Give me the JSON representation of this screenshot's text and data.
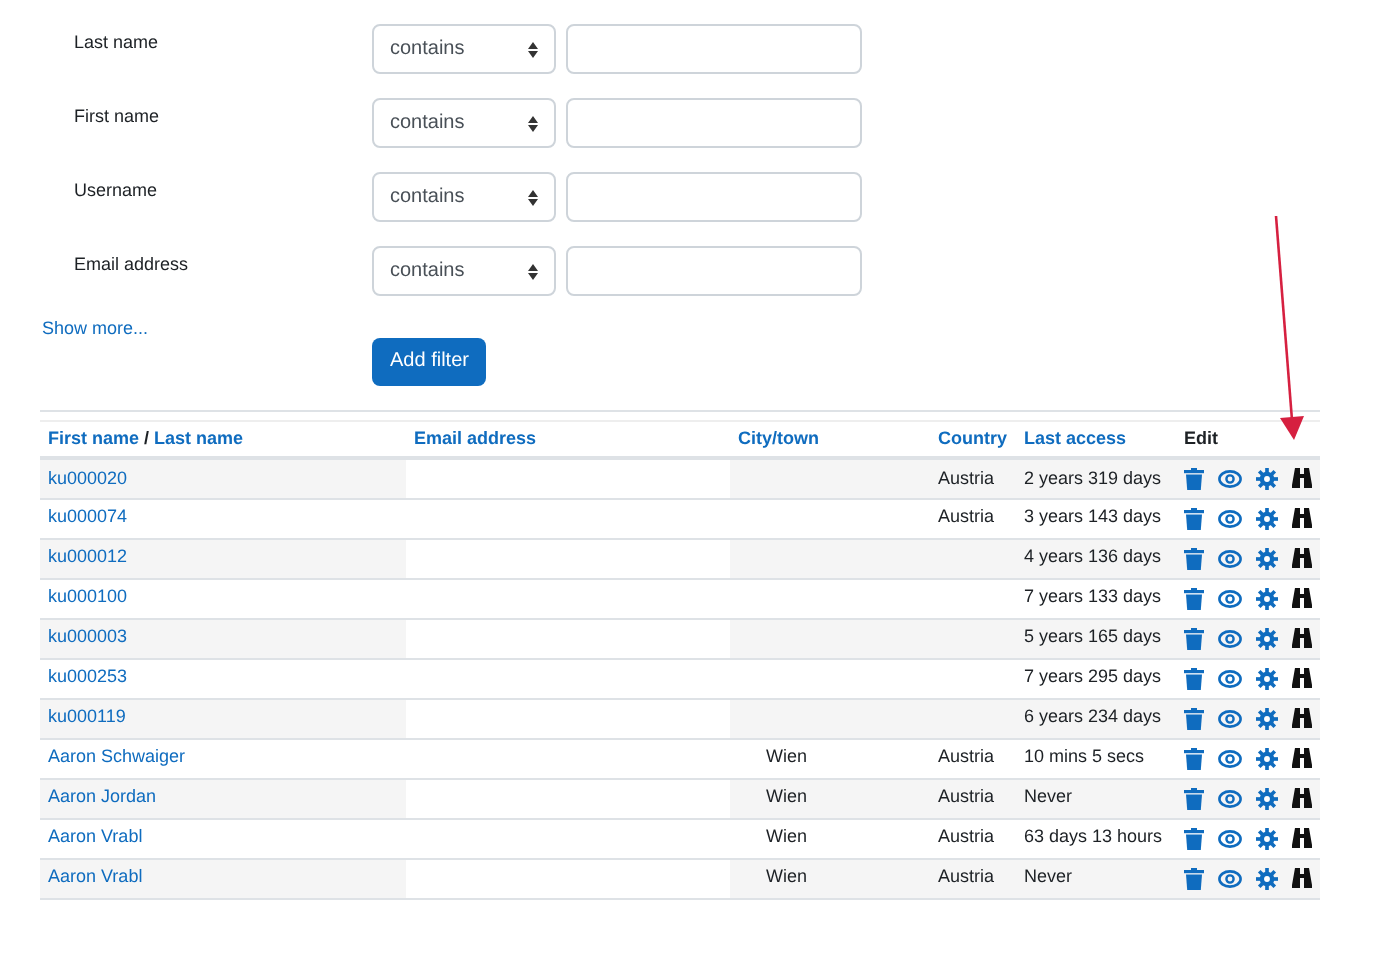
{
  "filters": [
    {
      "label": "Last name",
      "operator": "contains"
    },
    {
      "label": "First name",
      "operator": "contains"
    },
    {
      "label": "Username",
      "operator": "contains"
    },
    {
      "label": "Email address",
      "operator": "contains"
    }
  ],
  "show_more": "Show more...",
  "add_filter_button": "Add filter",
  "table": {
    "columns": [
      {
        "kind": "name",
        "parts": [
          "First name",
          "Last name"
        ],
        "separator": "/"
      },
      {
        "kind": "link",
        "label": "Email address"
      },
      {
        "kind": "link",
        "label": "City/town"
      },
      {
        "kind": "link",
        "label": "Country"
      },
      {
        "kind": "link",
        "label": "Last access"
      },
      {
        "kind": "plain",
        "label": "Edit"
      }
    ],
    "rows": [
      {
        "name": "ku000020",
        "email": "",
        "city": "",
        "country": "Austria",
        "last_access": "2 years 319 days"
      },
      {
        "name": "ku000074",
        "email": "",
        "city": "",
        "country": "Austria",
        "last_access": "3 years 143 days"
      },
      {
        "name": "ku000012",
        "email": "",
        "city": "",
        "country": "",
        "last_access": "4 years 136 days"
      },
      {
        "name": "ku000100",
        "email": "",
        "city": "",
        "country": "",
        "last_access": "7 years 133 days"
      },
      {
        "name": "ku000003",
        "email": "",
        "city": "",
        "country": "",
        "last_access": "5 years 165 days"
      },
      {
        "name": "ku000253",
        "email": "",
        "city": "",
        "country": "",
        "last_access": "7 years 295 days"
      },
      {
        "name": "ku000119",
        "email": "",
        "city": "",
        "country": "",
        "last_access": "6 years 234 days"
      },
      {
        "name": "Aaron Schwaiger",
        "email": "",
        "city": "Wien",
        "country": "Austria",
        "last_access": "10 mins 5 secs"
      },
      {
        "name": "Aaron Jordan",
        "email": "",
        "city": "Wien",
        "country": "Austria",
        "last_access": "Never"
      },
      {
        "name": "Aaron Vrabl",
        "email": "",
        "city": "Wien",
        "country": "Austria",
        "last_access": "63 days 13 hours"
      },
      {
        "name": "Aaron Vrabl",
        "email": "",
        "city": "Wien",
        "country": "Austria",
        "last_access": "Never"
      }
    ]
  }
}
